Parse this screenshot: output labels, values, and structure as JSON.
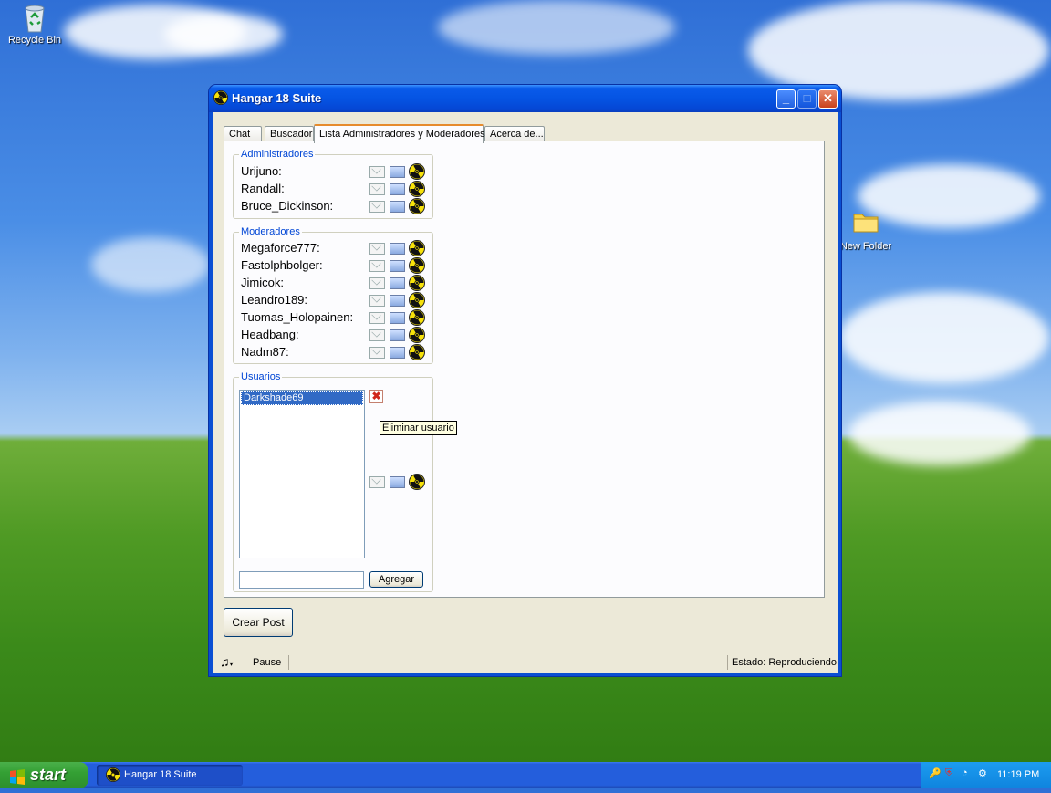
{
  "desktop": {
    "icons": [
      {
        "label": "Recycle Bin",
        "icon": "recycle-bin-icon"
      },
      {
        "label": "New Folder",
        "icon": "folder-icon"
      }
    ]
  },
  "window": {
    "title": "Hangar 18 Suite",
    "icon": "radiation-icon",
    "tabs": [
      {
        "label": "Chat"
      },
      {
        "label": "Buscador"
      },
      {
        "label": "Lista Administradores y Moderadores",
        "active": true
      },
      {
        "label": "Acerca de..."
      }
    ],
    "administradores": {
      "legend": "Administradores",
      "users": [
        "Urijuno:",
        "Randall:",
        "Bruce_Dickinson:"
      ]
    },
    "moderadores": {
      "legend": "Moderadores",
      "users": [
        "Megaforce777:",
        "Fastolphbolger:",
        "Jimicok:",
        "Leandro189:",
        "Tuomas_Holopainen:",
        "Headbang:",
        "Nadm87:"
      ]
    },
    "usuarios": {
      "legend": "Usuarios",
      "list": [
        "Darkshade69"
      ],
      "selected": "Darkshade69",
      "tooltip": "Eliminar usuario",
      "add_value": "",
      "add_button": "Agregar"
    },
    "create_post_button": "Crear Post",
    "status": {
      "pause_label": "Pause",
      "estado": "Estado: Reproduciendo"
    }
  },
  "taskbar": {
    "start_label": "start",
    "task_label": "Hangar 18 Suite",
    "clock": "11:19 PM"
  }
}
